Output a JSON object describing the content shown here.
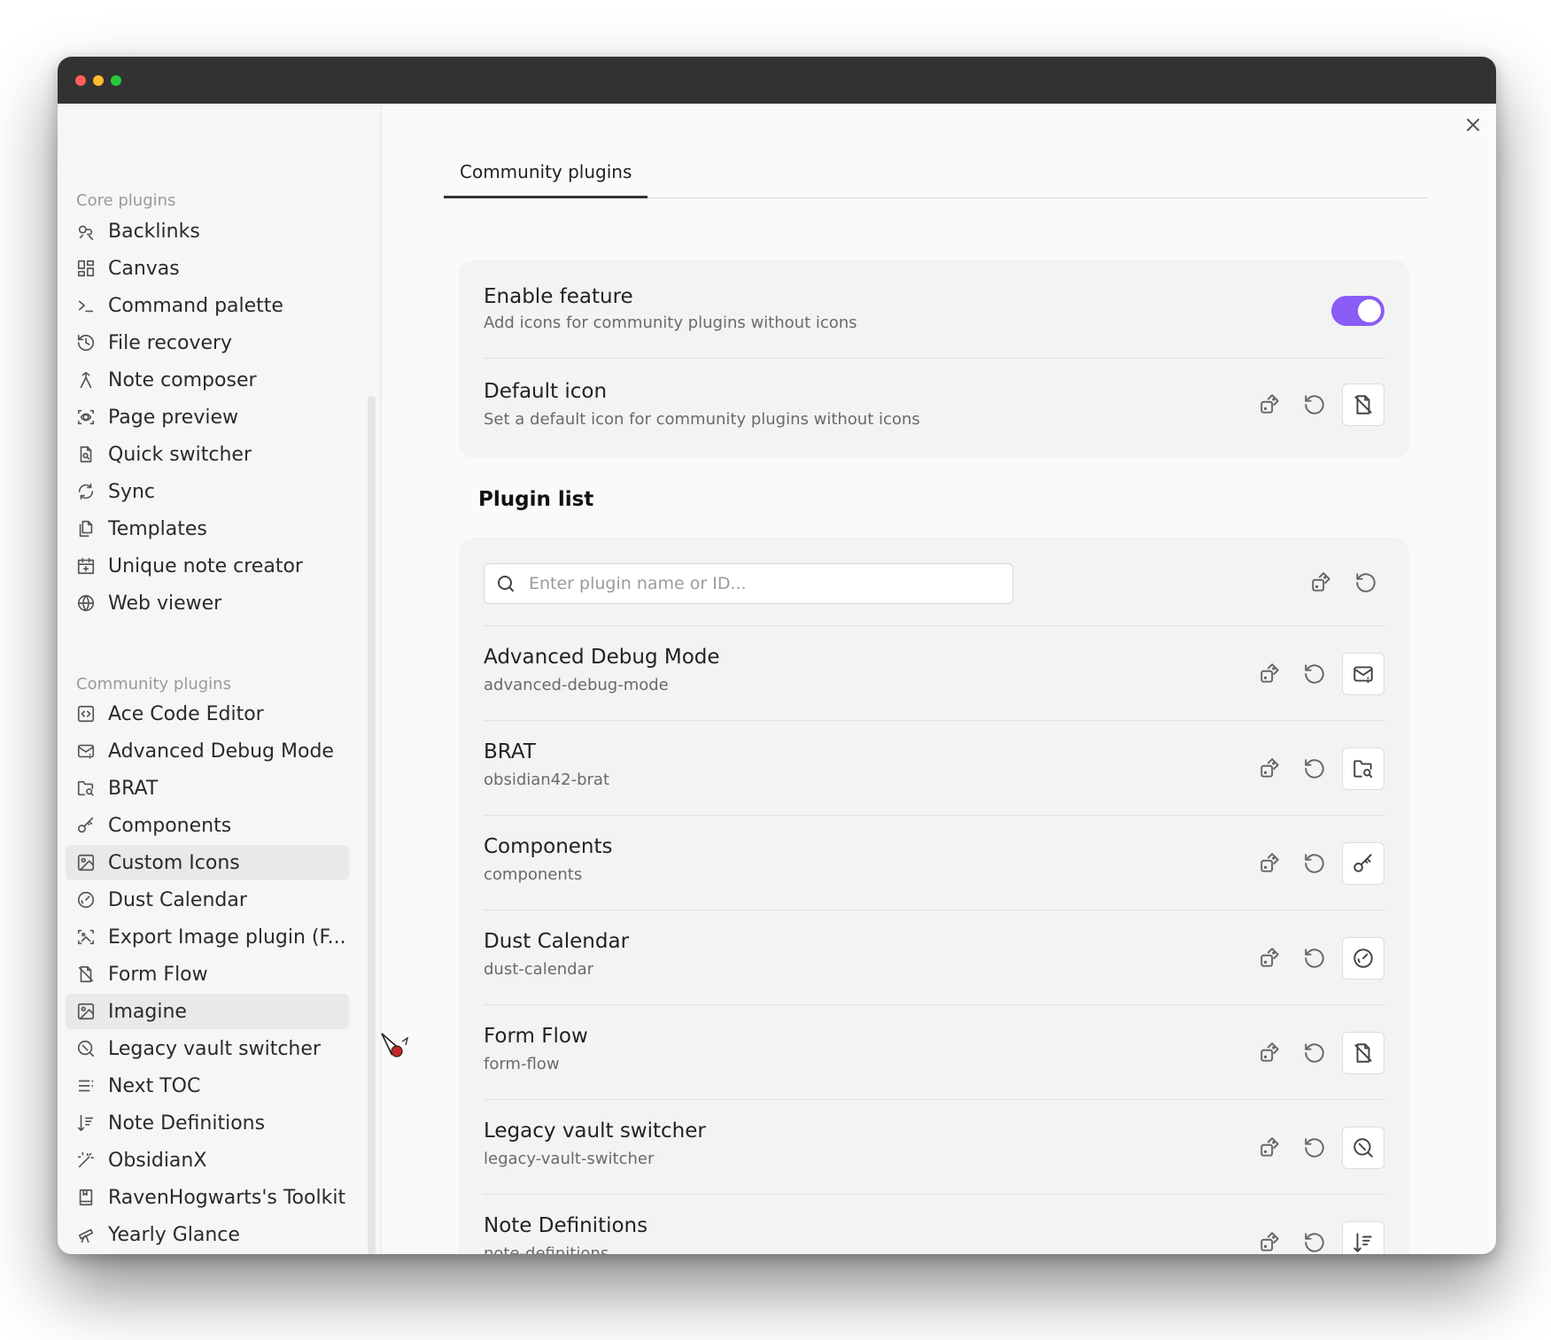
{
  "sidebar": {
    "core_title": "Core plugins",
    "core_items": [
      {
        "label": "Backlinks",
        "icon": "backlinks-icon"
      },
      {
        "label": "Canvas",
        "icon": "canvas-icon"
      },
      {
        "label": "Command palette",
        "icon": "terminal-icon"
      },
      {
        "label": "File recovery",
        "icon": "history-icon"
      },
      {
        "label": "Note composer",
        "icon": "merge-icon"
      },
      {
        "label": "Page preview",
        "icon": "preview-icon"
      },
      {
        "label": "Quick switcher",
        "icon": "file-search-icon"
      },
      {
        "label": "Sync",
        "icon": "sync-icon"
      },
      {
        "label": "Templates",
        "icon": "files-icon"
      },
      {
        "label": "Unique note creator",
        "icon": "calendar-plus-icon"
      },
      {
        "label": "Web viewer",
        "icon": "globe-icon"
      }
    ],
    "community_title": "Community plugins",
    "community_items": [
      {
        "label": "Ace Code Editor",
        "icon": "code-square-icon"
      },
      {
        "label": "Advanced Debug Mode",
        "icon": "mail-question-icon"
      },
      {
        "label": "BRAT",
        "icon": "folder-search-icon"
      },
      {
        "label": "Components",
        "icon": "key-icon"
      },
      {
        "label": "Custom Icons",
        "icon": "image-icon"
      },
      {
        "label": "Dust Calendar",
        "icon": "gauge-icon"
      },
      {
        "label": "Export Image plugin (F...",
        "icon": "scan-image-icon"
      },
      {
        "label": "Form Flow",
        "icon": "file-off-icon"
      },
      {
        "label": "Imagine",
        "icon": "image-icon"
      },
      {
        "label": "Legacy vault switcher",
        "icon": "search-slash-icon"
      },
      {
        "label": "Next TOC",
        "icon": "list-icon"
      },
      {
        "label": "Note Definitions",
        "icon": "sort-icon"
      },
      {
        "label": "ObsidianX",
        "icon": "magic-wand-icon"
      },
      {
        "label": "RavenHogwarts's Toolkit",
        "icon": "notebook-icon"
      },
      {
        "label": "Yearly Glance",
        "icon": "telescope-icon"
      }
    ]
  },
  "main": {
    "tab_label": "Community plugins",
    "enable_feature": {
      "name": "Enable feature",
      "description": "Add icons for community plugins without icons",
      "enabled": true
    },
    "default_icon": {
      "name": "Default icon",
      "description": "Set a default icon for community plugins without icons",
      "icon": "file-off-icon"
    },
    "plugin_list_title": "Plugin list",
    "search_placeholder": "Enter plugin name or ID...",
    "plugins": [
      {
        "name": "Advanced Debug Mode",
        "id": "advanced-debug-mode",
        "icon": "mail-question-icon"
      },
      {
        "name": "BRAT",
        "id": "obsidian42-brat",
        "icon": "folder-search-icon"
      },
      {
        "name": "Components",
        "id": "components",
        "icon": "key-icon"
      },
      {
        "name": "Dust Calendar",
        "id": "dust-calendar",
        "icon": "gauge-icon"
      },
      {
        "name": "Form Flow",
        "id": "form-flow",
        "icon": "file-off-icon"
      },
      {
        "name": "Legacy vault switcher",
        "id": "legacy-vault-switcher",
        "icon": "search-slash-icon"
      },
      {
        "name": "Note Definitions",
        "id": "note-definitions",
        "icon": "sort-icon"
      }
    ]
  },
  "colors": {
    "accent": "#8b5cf6",
    "titlebar": "#323232"
  }
}
